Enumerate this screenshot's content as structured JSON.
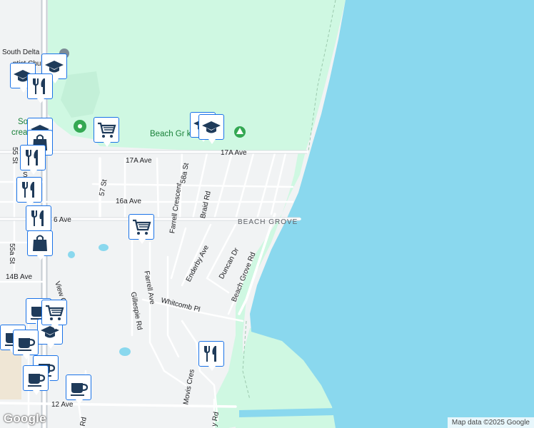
{
  "map": {
    "colors": {
      "water": "#8ad8ee",
      "park": "#cff8e2",
      "land": "#f1f3f4",
      "road": "#ffffff",
      "major_road": "#c7cdd3",
      "pin_border": "#1a73e8",
      "pin_icon": "#1f3b5a",
      "poi_green": "#188038"
    }
  },
  "labels": {
    "south_delta_church_line1": "South Delta",
    "south_delta_church_line2": "ptist Chur",
    "rec_centre_line1": "So    elta",
    "rec_centre_line2": "creatio  ntre",
    "beach_grove_park": "Beach Gr      k",
    "beach_grove": "BEACH GROVE",
    "ave_17a_east": "17A Ave",
    "ave_17a_west": "17A Ave",
    "ave_16a": "16a Ave",
    "ave_16": "6 Ave",
    "ave_14b": "14B Ave",
    "ave_12": "12 Ave",
    "st_55": "55 St",
    "st_55a": "55a St",
    "st_57": "57 St",
    "st_58a": "58a St",
    "st_s": "S",
    "farrell_crescent": "Farrell Crescent",
    "braid_rd": "Braid Rd",
    "enderby_ave": "Enderby Ave",
    "duncan_dr": "Duncan Dr",
    "beach_grove_rd": "Beach Grove Rd",
    "farrell_ave": "Farrell Ave",
    "gillespie_rd": "Gillespie Rd",
    "whitcomb_pl": "Whitcomb Pl",
    "view_c": "View C",
    "movis_cres": "Movis Cres",
    "rd_bottom_1": "Rd",
    "rd_bottom_2": "y Rd"
  },
  "pins": [
    {
      "icon": "graduation-cap-icon"
    },
    {
      "icon": "graduation-cap-icon"
    },
    {
      "icon": "restaurant-icon"
    },
    {
      "icon": "shopping-cart-icon"
    },
    {
      "icon": "graduation-cap-icon"
    },
    {
      "icon": "graduation-cap-icon"
    },
    {
      "icon": "graduation-cap-icon"
    },
    {
      "icon": "shopping-bag-icon"
    },
    {
      "icon": "restaurant-icon"
    },
    {
      "icon": "restaurant-icon"
    },
    {
      "icon": "restaurant-icon"
    },
    {
      "icon": "shopping-bag-icon"
    },
    {
      "icon": "shopping-cart-icon"
    },
    {
      "icon": "coffee-cup-icon"
    },
    {
      "icon": "coffee-cup-icon"
    },
    {
      "icon": "graduation-cap-icon"
    },
    {
      "icon": "shopping-cart-icon"
    },
    {
      "icon": "coffee-cup-icon"
    },
    {
      "icon": "coffee-cup-icon"
    },
    {
      "icon": "coffee-cup-icon"
    },
    {
      "icon": "coffee-cup-icon"
    },
    {
      "icon": "restaurant-icon"
    }
  ],
  "footer": {
    "attribution": "Map data ©2025 Google",
    "logo": "Google"
  }
}
